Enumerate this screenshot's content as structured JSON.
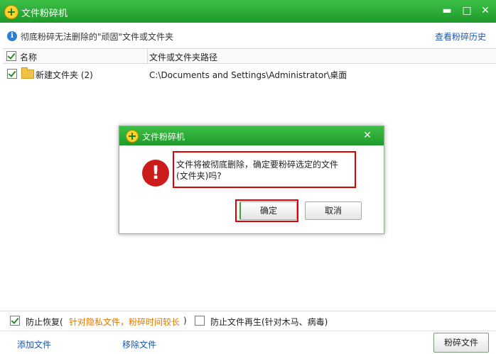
{
  "window": {
    "title": "文件粉碎机"
  },
  "window_buttons": {
    "minimize": "▬",
    "maximize": "□",
    "close": "✕"
  },
  "info": {
    "message": "彻底粉碎无法删除的\"顽固\"文件或文件夹",
    "history_link": "查看粉碎历史"
  },
  "list": {
    "headers": [
      "名称",
      "文件或文件夹路径"
    ],
    "rows": [
      {
        "checked": true,
        "name": "新建文件夹 (2)",
        "path": "C:\\Documents and Settings\\Administrator\\桌面"
      }
    ]
  },
  "options": {
    "prevent_recover": {
      "label": "防止恢复(",
      "note": "针对隐私文件，粉碎时间较长",
      "end": ")",
      "checked": true
    },
    "prevent_regen": {
      "label": "防止文件再生(针对木马、病毒)",
      "checked": false
    }
  },
  "footer": {
    "add_file": "添加文件",
    "remove_file": "移除文件",
    "shred_button": "粉碎文件"
  },
  "dialog": {
    "title": "文件粉碎机",
    "close": "✕",
    "error_symbol": "!",
    "message_line1": "文件将被彻底删除，确定要粉碎选定的文件",
    "message_line2": "(文件夹)吗?",
    "ok": "确定",
    "cancel": "取消"
  },
  "colors": {
    "titlebar": "#2aa836",
    "link": "#1a56b0",
    "note": "#e07a00",
    "highlight": "#e00000",
    "error": "#cc1b1b"
  }
}
